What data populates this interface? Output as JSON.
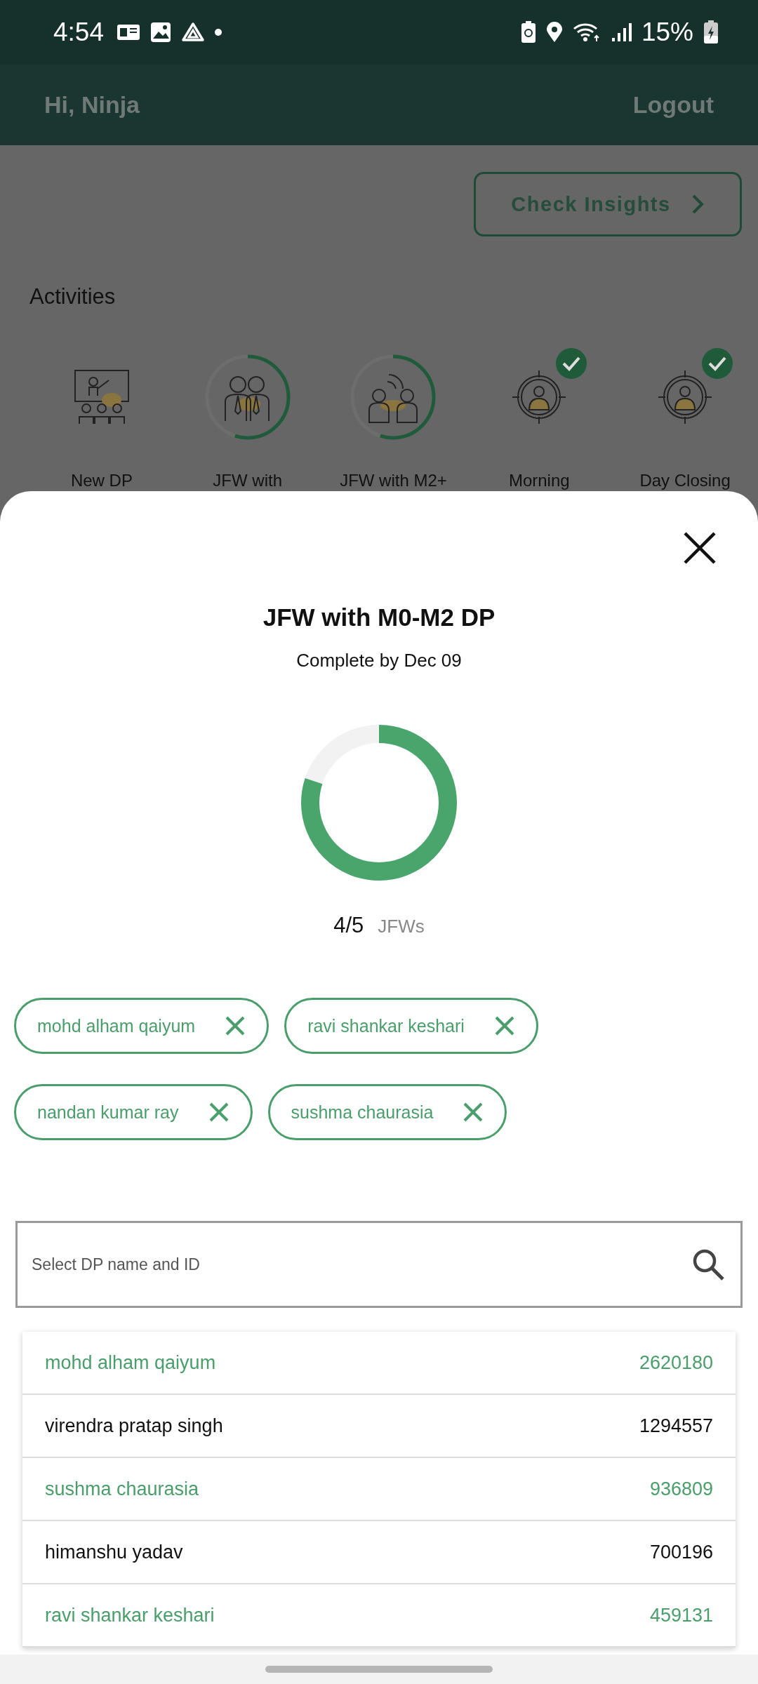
{
  "status_bar": {
    "time": "4:54",
    "battery": "15%"
  },
  "header": {
    "greeting": "Hi, Ninja",
    "logout": "Logout"
  },
  "insights_button": {
    "label": "Check Insights"
  },
  "activities": {
    "title": "Activities",
    "items": [
      {
        "label": "New DP",
        "kind": "plain"
      },
      {
        "label": "JFW with",
        "kind": "progress",
        "level": 0.55
      },
      {
        "label": "JFW with M2+",
        "kind": "progress",
        "level": 0.55
      },
      {
        "label": "Morning",
        "kind": "done"
      },
      {
        "label": "Day Closing",
        "kind": "done"
      }
    ]
  },
  "sheet": {
    "title": "JFW with M0-M2 DP",
    "subtitle": "Complete by Dec 09",
    "progress": {
      "level": 0.8,
      "count": "4/5",
      "unit": "JFWs"
    },
    "chips": [
      "mohd alham qaiyum",
      "ravi shankar keshari",
      "nandan kumar ray",
      "sushma chaurasia"
    ],
    "search": {
      "placeholder": "Select DP name and ID"
    },
    "results": [
      {
        "name": "mohd alham qaiyum",
        "id": "2620180",
        "selected": true
      },
      {
        "name": "virendra pratap singh",
        "id": "1294557",
        "selected": false
      },
      {
        "name": "sushma chaurasia",
        "id": "936809",
        "selected": true
      },
      {
        "name": "himanshu yadav",
        "id": "700196",
        "selected": false
      },
      {
        "name": "ravi shankar keshari",
        "id": "459131",
        "selected": true
      }
    ]
  }
}
